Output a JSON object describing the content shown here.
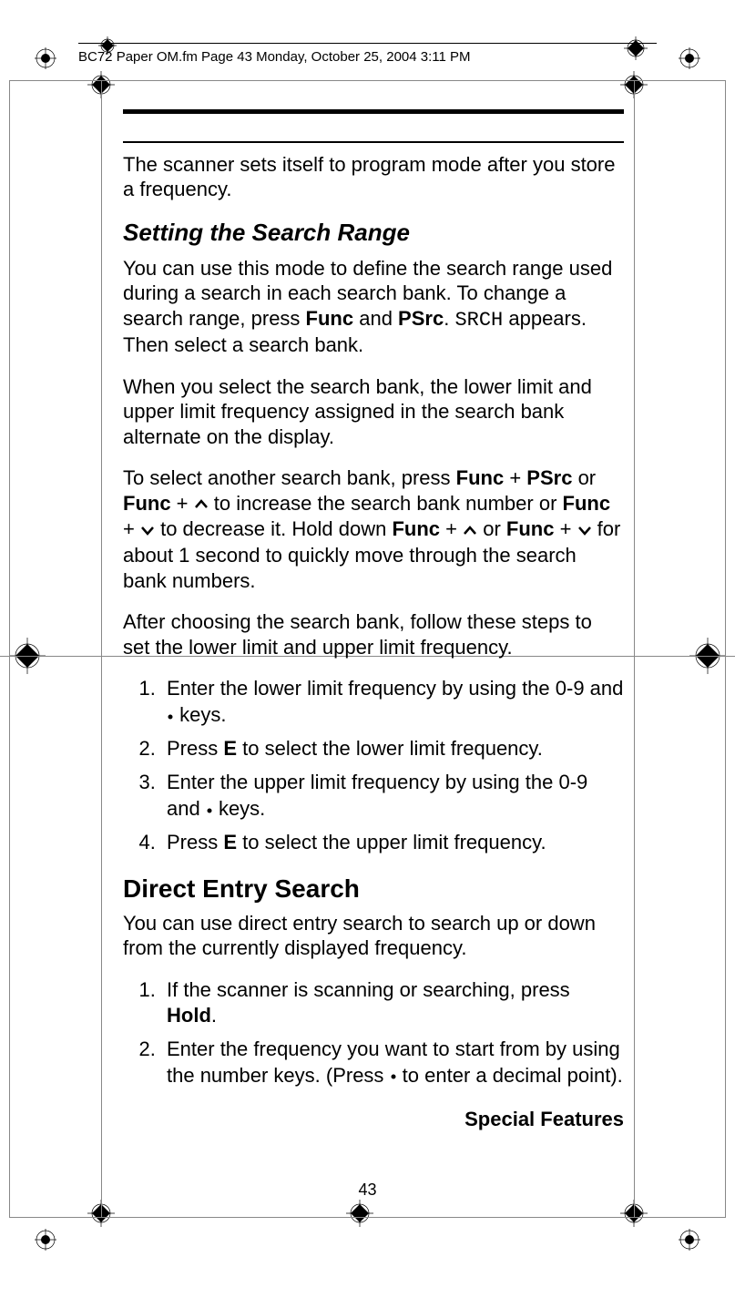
{
  "header": "BC72 Paper OM.fm  Page 43  Monday, October 25, 2004  3:11 PM",
  "intro": "The scanner sets itself to program mode after you store a frequency.",
  "section1_title": "Setting the Search Range",
  "p1a": "You can use this mode to define the search range used during a search in each search bank. To change a search range, press ",
  "p1b": " and ",
  "p1c": ". ",
  "p1d": " appears. Then select a search bank.",
  "func": "Func",
  "psrc": "PSrc",
  "srch": "SRCH",
  "p2": "When you select the search bank, the lower limit and upper limit frequency assigned in the search bank alternate on the display.",
  "p3a": "To select another search bank, press ",
  "p3b": " or ",
  "p3c": "  to increase the search bank number or ",
  "p3d": " to decrease it. Hold down ",
  "p3e": " or ",
  "p3f": " for about 1 second to quickly move through the search bank numbers.",
  "plus": " + ",
  "p4": "After choosing the search bank, follow these steps to set the lower limit and upper limit frequency.",
  "list1": {
    "i1a": "Enter the lower limit frequency by using the 0-9 and ",
    "i1b": " keys.",
    "i2a": "Press ",
    "i2b": " to select the lower limit frequency.",
    "i3a": "Enter the upper limit frequency by using the 0-9 and ",
    "i3b": " keys.",
    "i4a": "Press ",
    "i4b": " to select the upper limit frequency."
  },
  "E": "E",
  "section2_title": "Direct Entry Search",
  "p5": "You can use direct entry search to search up or down from the currently displayed frequency.",
  "list2": {
    "i1a": "If the scanner is scanning or searching, press ",
    "i1b": ".",
    "i2a": "Enter the frequency you want to start from by using the number keys. (Press ",
    "i2b": "  to enter a decimal point)."
  },
  "hold": "Hold",
  "footer_title": "Special Features",
  "page_number": "43"
}
